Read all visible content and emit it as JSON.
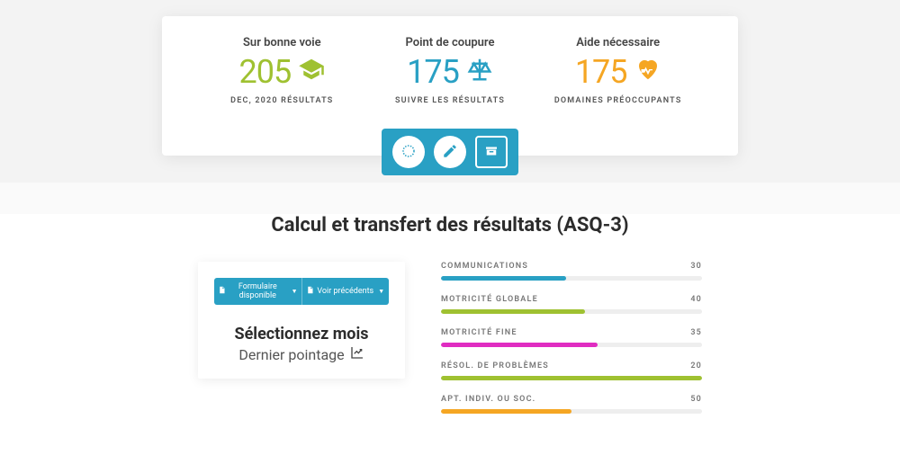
{
  "stats": {
    "onTrack": {
      "title": "Sur bonne voie",
      "value": "205",
      "sub": "DEC, 2020 RÉSULTATS"
    },
    "cutoff": {
      "title": "Point de coupure",
      "value": "175",
      "sub": "SUIVRE LES RÉSULTATS"
    },
    "help": {
      "title": "Aide nécessaire",
      "value": "175",
      "sub": "DOMAINES PRÉOCCUPANTS"
    }
  },
  "sectionTitle": "Calcul et transfert des résultats (ASQ-3)",
  "formCard": {
    "btn1": "Formulaire disponible",
    "btn2": "Voir précédents",
    "selectMonth": "Sélectionnez mois",
    "lastScore": "Dernier pointage"
  },
  "chart_data": {
    "type": "bar",
    "title": "ASQ-3",
    "xlabel": "",
    "ylabel": "",
    "ylim": [
      0,
      60
    ],
    "series": [
      {
        "name": "COMMUNICATIONS",
        "value": 30,
        "fill_pct": 48,
        "color": "teal"
      },
      {
        "name": "MOTRICITÉ GLOBALE",
        "value": 40,
        "fill_pct": 55,
        "color": "lime"
      },
      {
        "name": "MOTRICITÉ FINE",
        "value": 35,
        "fill_pct": 60,
        "color": "magenta"
      },
      {
        "name": "RÉSOL. DE PROBLÈMES",
        "value": 20,
        "fill_pct": 100,
        "color": "lime"
      },
      {
        "name": "APT. INDIV. OU SOC.",
        "value": 50,
        "fill_pct": 50,
        "color": "orange"
      }
    ]
  }
}
